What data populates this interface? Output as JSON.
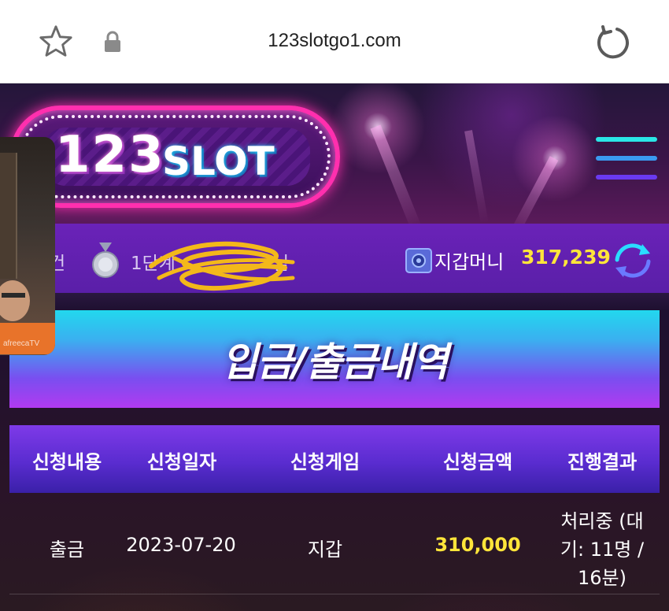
{
  "browser": {
    "url": "123slotgo1.com"
  },
  "site": {
    "logo_number": "123",
    "logo_word": "SLOT"
  },
  "video_overlay": {
    "watermark": "afreecaTV"
  },
  "user_bar": {
    "left_label": "건",
    "level_prefix": "1단계",
    "level_suffix": "님",
    "wallet_label": "지갑머니",
    "wallet_amount": "317,239"
  },
  "page": {
    "title": "입금/출금내역"
  },
  "table": {
    "headers": [
      "신청내용",
      "신청일자",
      "신청게임",
      "신청금액",
      "진행결과"
    ],
    "rows": [
      {
        "type": "출금",
        "date": "2023-07-20",
        "game": "지갑",
        "amount": "310,000",
        "result_line1": "처리중 (대",
        "result_line2": "기: 11명 /",
        "result_line3": "16분)"
      }
    ]
  },
  "colors": {
    "accent_yellow": "#ffe53a",
    "header_purple": "#6a22b8",
    "banner_cyan": "#22d8ee",
    "logo_pink": "#ff2fae"
  },
  "icons": [
    "star-icon",
    "lock-icon",
    "reload-icon",
    "hamburger-menu-icon",
    "medal-icon",
    "wallet-icon",
    "refresh-icon"
  ]
}
